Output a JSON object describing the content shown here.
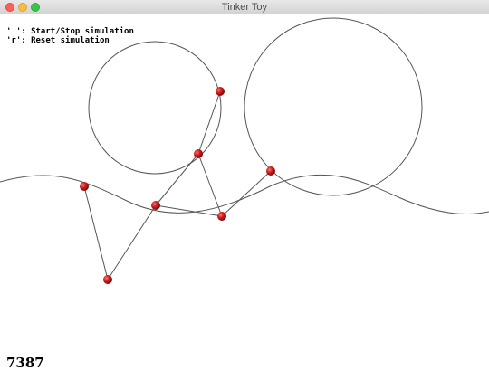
{
  "window": {
    "title": "Tinker Toy"
  },
  "help": {
    "line1": "' ': Start/Stop simulation",
    "line2": "'r': Reset simulation"
  },
  "counter": "7387",
  "colors": {
    "particle": "#c8191b",
    "wire": "#555555",
    "background": "#ffffff"
  }
}
